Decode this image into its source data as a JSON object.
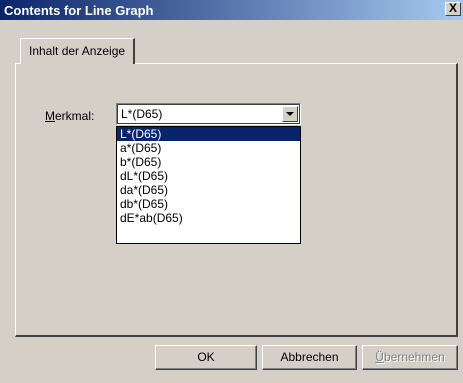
{
  "window": {
    "title": "Contents for Line Graph",
    "close_label": "X"
  },
  "tabs": [
    {
      "label": "Inhalt der Anzeige"
    }
  ],
  "merkmal": {
    "label_prefix": "M",
    "label_rest": "erkmal:",
    "selected": "L*(D65)",
    "options": [
      "L*(D65)",
      "a*(D65)",
      "b*(D65)",
      "dL*(D65)",
      "da*(D65)",
      "db*(D65)",
      "dE*ab(D65)"
    ]
  },
  "buttons": {
    "ok": "OK",
    "cancel": "Abbrechen",
    "apply_prefix": "Ü",
    "apply_rest": "bernehmen"
  }
}
